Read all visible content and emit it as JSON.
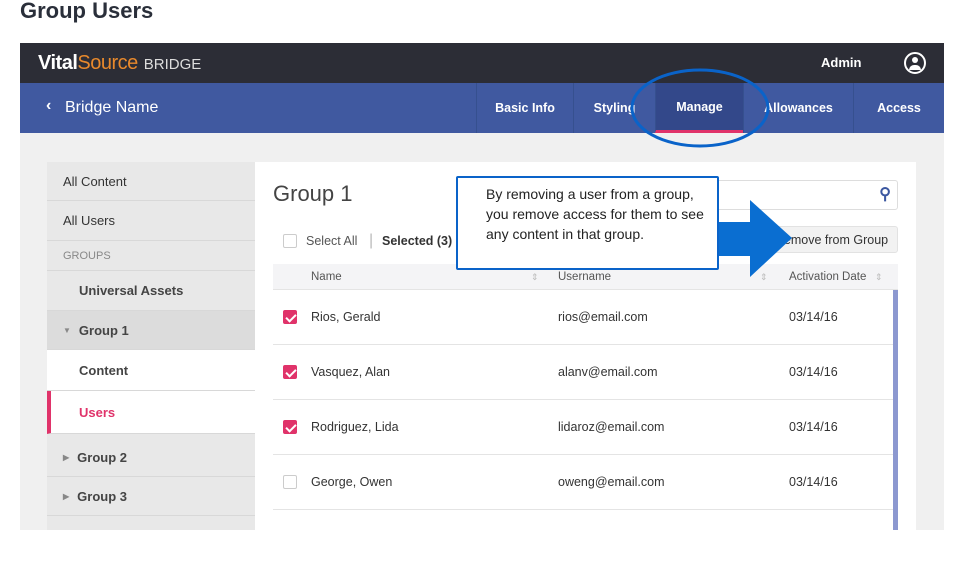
{
  "page_title": "Group Users",
  "header": {
    "logo_vital": "Vital",
    "logo_source": "Source",
    "logo_bridge": "BRIDGE",
    "admin_label": "Admin"
  },
  "nav": {
    "back_label": "Bridge Name",
    "tabs": [
      {
        "label": "Basic Info"
      },
      {
        "label": "Styling"
      },
      {
        "label": "Manage",
        "active": true
      },
      {
        "label": "Allowances"
      },
      {
        "label": "Access"
      }
    ]
  },
  "sidebar": {
    "all_content": "All Content",
    "all_users": "All Users",
    "groups_header": "GROUPS",
    "universal_assets": "Universal Assets",
    "group1": "Group 1",
    "content": "Content",
    "users": "Users",
    "group2": "Group 2",
    "group3": "Group 3"
  },
  "main": {
    "title": "Group 1",
    "select_all": "Select All",
    "selected": "Selected (3)",
    "remove_button": "Remove from Group",
    "columns": [
      "Name",
      "Username",
      "Activation Date"
    ],
    "rows": [
      {
        "name": "Rios, Gerald",
        "username": "rios@email.com",
        "date": "03/14/16",
        "checked": true
      },
      {
        "name": "Vasquez, Alan",
        "username": "alanv@email.com",
        "date": "03/14/16",
        "checked": true
      },
      {
        "name": "Rodriguez, Lida",
        "username": "lidaroz@email.com",
        "date": "03/14/16",
        "checked": true
      },
      {
        "name": "George, Owen",
        "username": "oweng@email.com",
        "date": "03/14/16",
        "checked": false
      }
    ]
  },
  "callout": {
    "text": "By removing a user from a group, you remove access for them to see any content in that group."
  },
  "colors": {
    "accent": "#e0336a",
    "nav": "#4059a0",
    "header": "#2c2d36",
    "annotation": "#0a63c9"
  }
}
